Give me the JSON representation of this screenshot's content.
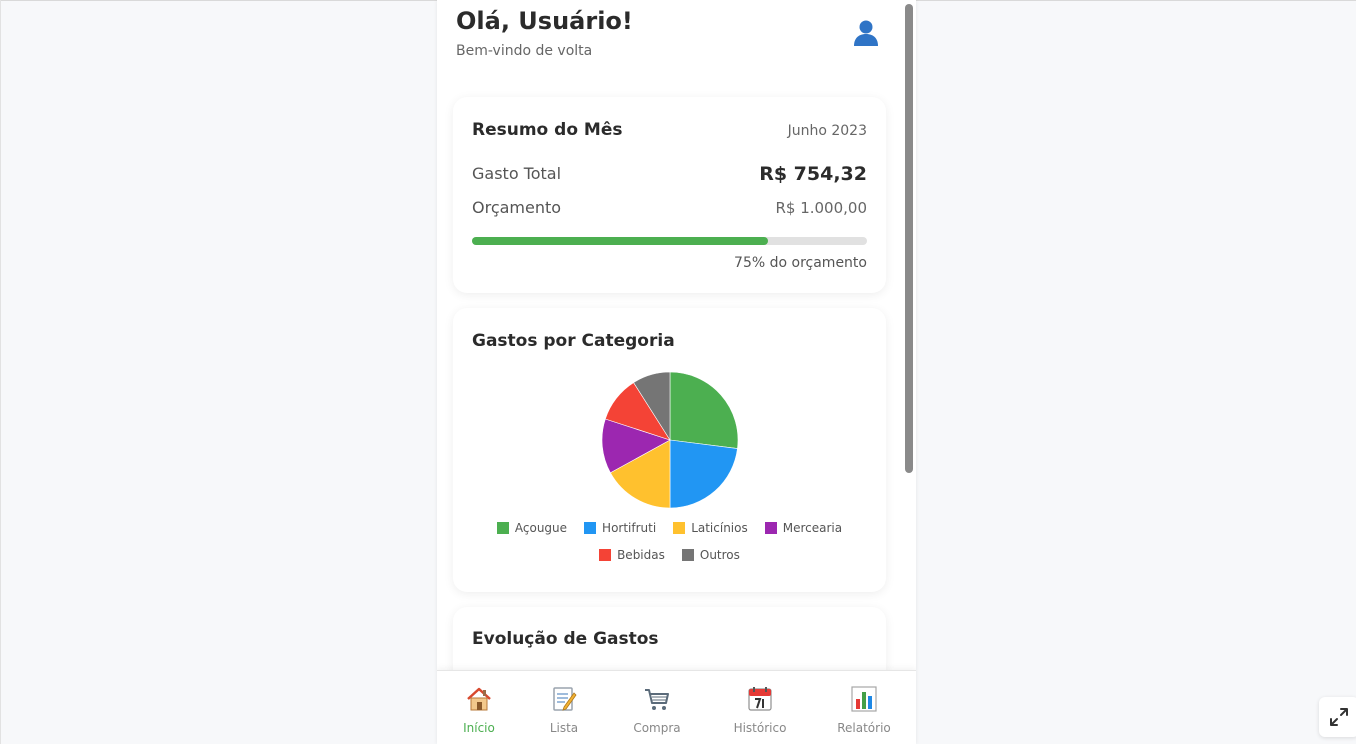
{
  "header": {
    "greeting": "Olá, Usuário!",
    "subtitle": "Bem-vindo de volta",
    "avatar_icon": "user-icon"
  },
  "summary": {
    "title": "Resumo do Mês",
    "month": "Junho 2023",
    "total_label": "Gasto Total",
    "total_value": "R$ 754,32",
    "budget_label": "Orçamento",
    "budget_value": "R$ 1.000,00",
    "progress_fraction": 0.75,
    "progress_text": "75% do orçamento",
    "progress_color": "#4caf50"
  },
  "category_card": {
    "title": "Gastos por Categoria"
  },
  "chart_data": {
    "type": "pie",
    "title": "Gastos por Categoria",
    "labels": [
      "Açougue",
      "Hortifruti",
      "Laticínios",
      "Mercearia",
      "Bebidas",
      "Outros"
    ],
    "values": [
      27,
      23,
      17,
      13,
      11,
      9
    ],
    "colors": [
      "#4caf50",
      "#2196f3",
      "#ffc12e",
      "#9c27b0",
      "#f44336",
      "#757575"
    ],
    "legend_position": "bottom"
  },
  "evolution_card": {
    "title": "Evolução de Gastos"
  },
  "nav": {
    "items": [
      {
        "label": "Início",
        "icon": "home-icon",
        "active": true
      },
      {
        "label": "Lista",
        "icon": "memo-icon",
        "active": false
      },
      {
        "label": "Compra",
        "icon": "shopping-cart-icon",
        "active": false
      },
      {
        "label": "Histórico",
        "icon": "calendar-icon",
        "active": false
      },
      {
        "label": "Relatório",
        "icon": "bar-chart-icon",
        "active": false
      }
    ],
    "active_color": "#4caf50"
  },
  "fullscreen_icon": "expand-icon"
}
